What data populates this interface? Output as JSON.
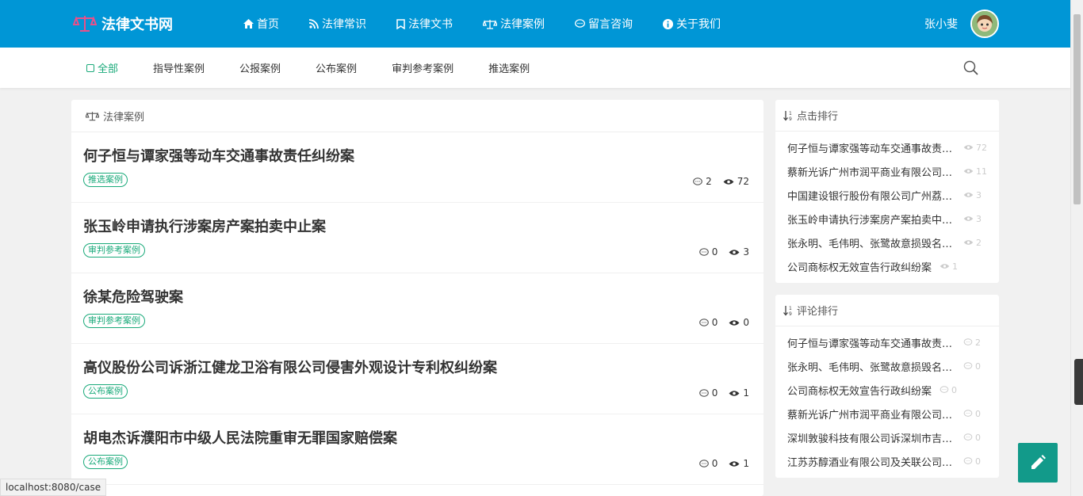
{
  "header": {
    "site_name": "法律文书网",
    "nav": [
      {
        "label": "首页",
        "icon": "home-icon"
      },
      {
        "label": "法律常识",
        "icon": "rss-icon"
      },
      {
        "label": "法律文书",
        "icon": "bookmark-icon"
      },
      {
        "label": "法律案例",
        "icon": "scale-icon"
      },
      {
        "label": "留言咨询",
        "icon": "chat-icon"
      },
      {
        "label": "关于我们",
        "icon": "info-icon"
      }
    ],
    "user_name": "张小斐"
  },
  "subnav": {
    "tabs": [
      {
        "label": "全部",
        "active": true
      },
      {
        "label": "指导性案例",
        "active": false
      },
      {
        "label": "公报案例",
        "active": false
      },
      {
        "label": "公布案例",
        "active": false
      },
      {
        "label": "审判参考案例",
        "active": false
      },
      {
        "label": "推选案例",
        "active": false
      }
    ]
  },
  "main": {
    "heading": "法律案例",
    "articles": [
      {
        "title": "何子恒与谭家强等动车交通事故责任纠纷案",
        "tag": "推选案例",
        "comments": "2",
        "views": "72"
      },
      {
        "title": "张玉岭申请执行涉案房产案拍卖中止案",
        "tag": "审判参考案例",
        "comments": "0",
        "views": "3"
      },
      {
        "title": "徐某危险驾驶案",
        "tag": "审判参考案例",
        "comments": "0",
        "views": "0"
      },
      {
        "title": "高仪股份公司诉浙江健龙卫浴有限公司侵害外观设计专利权纠纷案",
        "tag": "公布案例",
        "comments": "0",
        "views": "1"
      },
      {
        "title": "胡电杰诉濮阳市中级人民法院重审无罪国家赔偿案",
        "tag": "公布案例",
        "comments": "0",
        "views": "1"
      }
    ]
  },
  "click_rank": {
    "heading": "点击排行",
    "items": [
      {
        "title": "何子恒与谭家强等动车交通事故责任纠纷案",
        "count": "72"
      },
      {
        "title": "蔡新光诉广州市润平商业有限公司侵害植物新品种权纠纷案",
        "count": "11"
      },
      {
        "title": "中国建设银行股份有限公司广州荔湾支行诉广东蓝粤能源发展有限公司等信用证开证纠纷案",
        "count": "3"
      },
      {
        "title": "张玉岭申请执行涉案房产案拍卖中止案",
        "count": "3"
      },
      {
        "title": "张永明、毛伟明、张鹭故意损毁名胜古迹案",
        "count": "2"
      },
      {
        "title": "公司商标权无效宣告行政纠纷案",
        "count": "1"
      }
    ]
  },
  "comment_rank": {
    "heading": "评论排行",
    "items": [
      {
        "title": "何子恒与谭家强等动车交通事故责任纠纷案",
        "count": "2"
      },
      {
        "title": "张永明、毛伟明、张鹭故意损毁名胜古迹案",
        "count": "0"
      },
      {
        "title": "公司商标权无效宣告行政纠纷案",
        "count": "0"
      },
      {
        "title": "蔡新光诉广州市润平商业有限公司侵害植物新品种权纠纷案",
        "count": "0"
      },
      {
        "title": "深圳敦骏科技有限公司诉深圳市吉祥腾达科技有限公司等侵害发明专利权纠纷案",
        "count": "0"
      },
      {
        "title": "江苏苏醇酒业有限公司及关联公司实质合并破产重整案",
        "count": "0"
      }
    ]
  },
  "status_url": "localhost:8080/case",
  "colors": {
    "primary": "#0096d6",
    "accent": "#1aaa7a",
    "fab": "#129a8a"
  }
}
